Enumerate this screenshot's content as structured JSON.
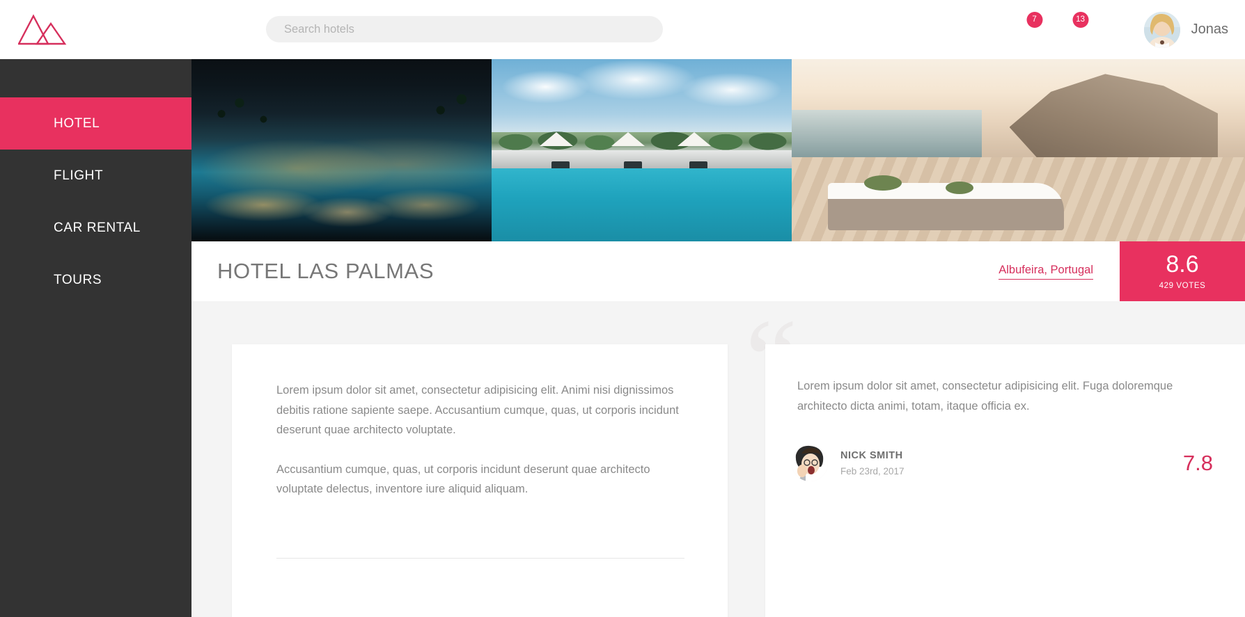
{
  "brand": {
    "logo_icon": "mountains-logo-icon",
    "accent": "#e8315f"
  },
  "search": {
    "placeholder": "Search hotels",
    "value": "",
    "icon": "search-icon"
  },
  "topbar": {
    "notifications": [
      {
        "icon": "bell-icon",
        "count": "7"
      },
      {
        "icon": "envelope-icon",
        "count": "13"
      }
    ],
    "user": {
      "name": "Jonas",
      "avatar_icon": "user-avatar"
    }
  },
  "sidebar": {
    "items": [
      {
        "label": "HOTEL",
        "active": true
      },
      {
        "label": "FLIGHT",
        "active": false
      },
      {
        "label": "CAR RENTAL",
        "active": false
      },
      {
        "label": "TOURS",
        "active": false
      }
    ]
  },
  "hero": {
    "images": [
      {
        "alt": "night-resort-pool"
      },
      {
        "alt": "daytime-pool-umbrellas"
      },
      {
        "alt": "sunset-cliff-terrace"
      }
    ]
  },
  "hotel": {
    "title": "HOTEL LAS PALMAS",
    "location": "Albufeira, Portugal",
    "rating": {
      "score": "8.6",
      "votes": "429 VOTES"
    }
  },
  "description": {
    "paragraph_1": "Lorem ipsum dolor sit amet, consectetur adipisicing elit. Animi nisi dignissimos debitis ratione sapiente saepe. Accusantium cumque, quas, ut corporis incidunt deserunt quae architecto voluptate.",
    "paragraph_2": "Accusantium cumque, quas, ut corporis incidunt deserunt quae architecto voluptate delectus, inventore iure aliquid aliquam."
  },
  "review": {
    "quote_glyph": "“",
    "text": "Lorem ipsum dolor sit amet, consectetur adipisicing elit. Fuga doloremque architecto dicta animi, totam, itaque officia ex.",
    "author": "NICK SMITH",
    "date": "Feb 23rd, 2017",
    "score": "7.8"
  }
}
